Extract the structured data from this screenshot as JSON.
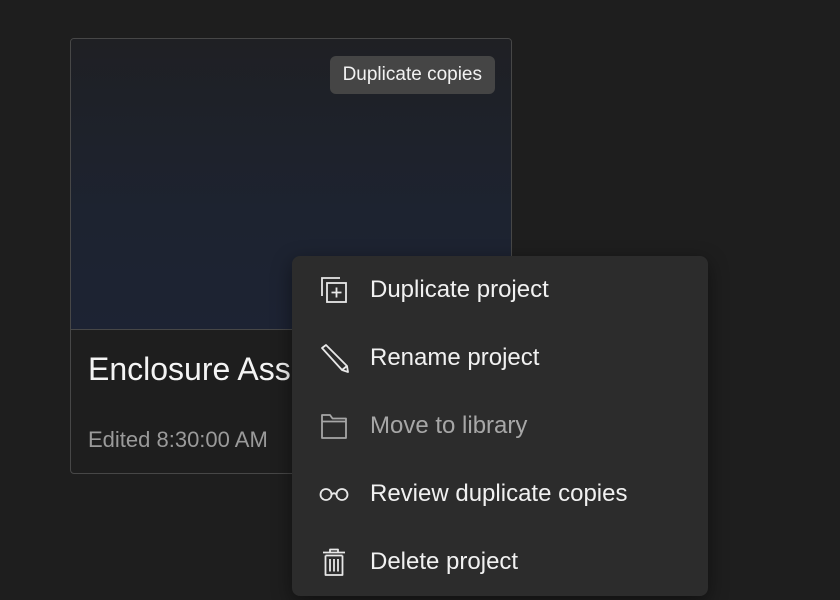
{
  "card": {
    "title": "Enclosure Ass",
    "meta": "Edited 8:30:00 AM",
    "badge": "Duplicate copies"
  },
  "menu": {
    "items": [
      {
        "label": "Duplicate project",
        "icon": "duplicate-icon",
        "enabled": true
      },
      {
        "label": "Rename project",
        "icon": "pencil-icon",
        "enabled": true
      },
      {
        "label": "Move to library",
        "icon": "folder-icon",
        "enabled": false
      },
      {
        "label": "Review duplicate copies",
        "icon": "glasses-icon",
        "enabled": true
      },
      {
        "label": "Delete project",
        "icon": "trash-icon",
        "enabled": true
      }
    ]
  },
  "colors": {
    "background": "#1e1e1e",
    "menu_background": "#2c2c2c",
    "badge_background": "#454545",
    "text": "#f1f1f1",
    "disabled_text": "#a7a7a7"
  }
}
